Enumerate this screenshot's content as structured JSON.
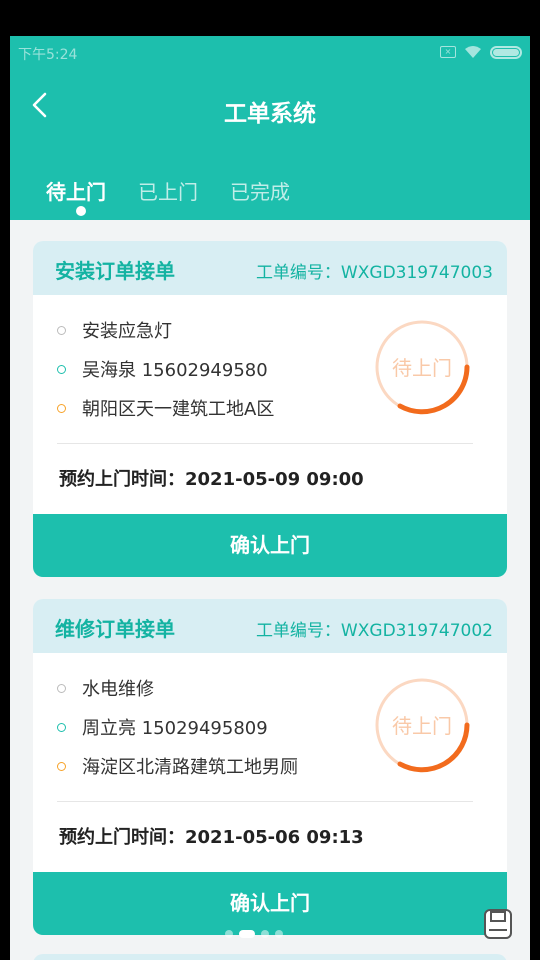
{
  "status_bar": {
    "time": "下午5:24"
  },
  "header": {
    "title": "工单系统"
  },
  "tabs": [
    {
      "label": "待上门",
      "active": true
    },
    {
      "label": "已上门",
      "active": false
    },
    {
      "label": "已完成",
      "active": false
    }
  ],
  "orders": [
    {
      "title": "安装订单接单",
      "order_no": "工单编号：WXGD319747003",
      "item": "安装应急灯",
      "contact": "吴海泉 15602949580",
      "address": "朝阳区天一建筑工地A区",
      "stamp": "待上门",
      "appointment": "预约上门时间：2021-05-09 09:00",
      "button": "确认上门"
    },
    {
      "title": "维修订单接单",
      "order_no": "工单编号：WXGD319747002",
      "item": "水电维修",
      "contact": "周立亮 15029495809",
      "address": "海淀区北清路建筑工地男厕",
      "stamp": "待上门",
      "appointment": "预约上门时间：2021-05-06 09:13",
      "button": "确认上门"
    }
  ],
  "colors": {
    "primary": "#1dbfad",
    "card_header": "#d8eef3",
    "stamp_orange": "#f26b1d"
  },
  "icons": {
    "back": "chevron-left-icon",
    "float": "save-icon"
  }
}
